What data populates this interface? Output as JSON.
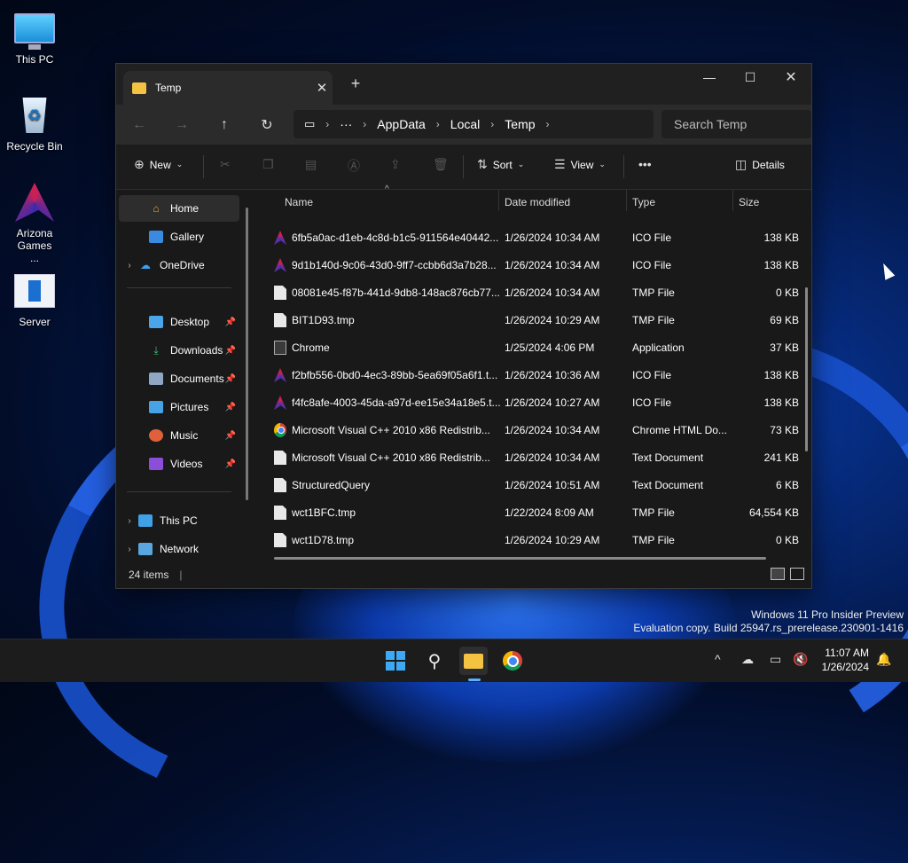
{
  "desktop": {
    "icons": [
      {
        "label": "This PC"
      },
      {
        "label": "Recycle Bin"
      },
      {
        "label": "Arizona Games ..."
      },
      {
        "label": "Server"
      }
    ]
  },
  "window": {
    "tab_title": "Temp",
    "breadcrumb": [
      "AppData",
      "Local",
      "Temp"
    ],
    "search_placeholder": "Search Temp",
    "toolbar": {
      "new": "New",
      "sort": "Sort",
      "view": "View",
      "details": "Details",
      "more": "•••"
    },
    "nav": {
      "items": [
        {
          "label": "Home",
          "icon": "home-icon"
        },
        {
          "label": "Gallery",
          "icon": "gallery-icon"
        },
        {
          "label": "OneDrive",
          "icon": "cloud-icon"
        },
        {
          "label": "Desktop",
          "icon": "desktop-icon"
        },
        {
          "label": "Downloads",
          "icon": "downloads-icon"
        },
        {
          "label": "Documents",
          "icon": "documents-icon"
        },
        {
          "label": "Pictures",
          "icon": "pictures-icon"
        },
        {
          "label": "Music",
          "icon": "music-icon"
        },
        {
          "label": "Videos",
          "icon": "videos-icon"
        },
        {
          "label": "This PC",
          "icon": "computer-icon"
        },
        {
          "label": "Network",
          "icon": "network-icon"
        }
      ]
    },
    "columns": {
      "name": "Name",
      "date": "Date modified",
      "type": "Type",
      "size": "Size"
    },
    "files": [
      {
        "name": "6fb5a0ac-d1eb-4c8d-b1c5-911564e40442...",
        "date": "1/26/2024 10:34 AM",
        "type": "ICO File",
        "size": "138 KB",
        "icon": "ico"
      },
      {
        "name": "9d1b140d-9c06-43d0-9ff7-ccbb6d3a7b28...",
        "date": "1/26/2024 10:34 AM",
        "type": "ICO File",
        "size": "138 KB",
        "icon": "ico"
      },
      {
        "name": "08081e45-f87b-441d-9db8-148ac876cb77...",
        "date": "1/26/2024 10:34 AM",
        "type": "TMP File",
        "size": "0 KB",
        "icon": "doc"
      },
      {
        "name": "BIT1D93.tmp",
        "date": "1/26/2024 10:29 AM",
        "type": "TMP File",
        "size": "69 KB",
        "icon": "doc"
      },
      {
        "name": "Chrome",
        "date": "1/25/2024 4:06 PM",
        "type": "Application",
        "size": "37 KB",
        "icon": "app"
      },
      {
        "name": "f2bfb556-0bd0-4ec3-89bb-5ea69f05a6f1.t...",
        "date": "1/26/2024 10:36 AM",
        "type": "ICO File",
        "size": "138 KB",
        "icon": "ico"
      },
      {
        "name": "f4fc8afe-4003-45da-a97d-ee15e34a18e5.t...",
        "date": "1/26/2024 10:27 AM",
        "type": "ICO File",
        "size": "138 KB",
        "icon": "ico"
      },
      {
        "name": "Microsoft Visual C++ 2010  x86 Redistrib...",
        "date": "1/26/2024 10:34 AM",
        "type": "Chrome HTML Do...",
        "size": "73 KB",
        "icon": "chrome"
      },
      {
        "name": "Microsoft Visual C++ 2010  x86 Redistrib...",
        "date": "1/26/2024 10:34 AM",
        "type": "Text Document",
        "size": "241 KB",
        "icon": "doc"
      },
      {
        "name": "StructuredQuery",
        "date": "1/26/2024 10:51 AM",
        "type": "Text Document",
        "size": "6 KB",
        "icon": "doc"
      },
      {
        "name": "wct1BFC.tmp",
        "date": "1/22/2024 8:09 AM",
        "type": "TMP File",
        "size": "64,554 KB",
        "icon": "doc"
      },
      {
        "name": "wct1D78.tmp",
        "date": "1/26/2024 10:29 AM",
        "type": "TMP File",
        "size": "0 KB",
        "icon": "doc"
      }
    ],
    "status": "24 items"
  },
  "watermark": {
    "line1": "Windows 11 Pro Insider Preview",
    "line2": "Evaluation copy. Build 25947.rs_prerelease.230901-1416"
  },
  "taskbar": {
    "time": "11:07 AM",
    "date": "1/26/2024"
  }
}
